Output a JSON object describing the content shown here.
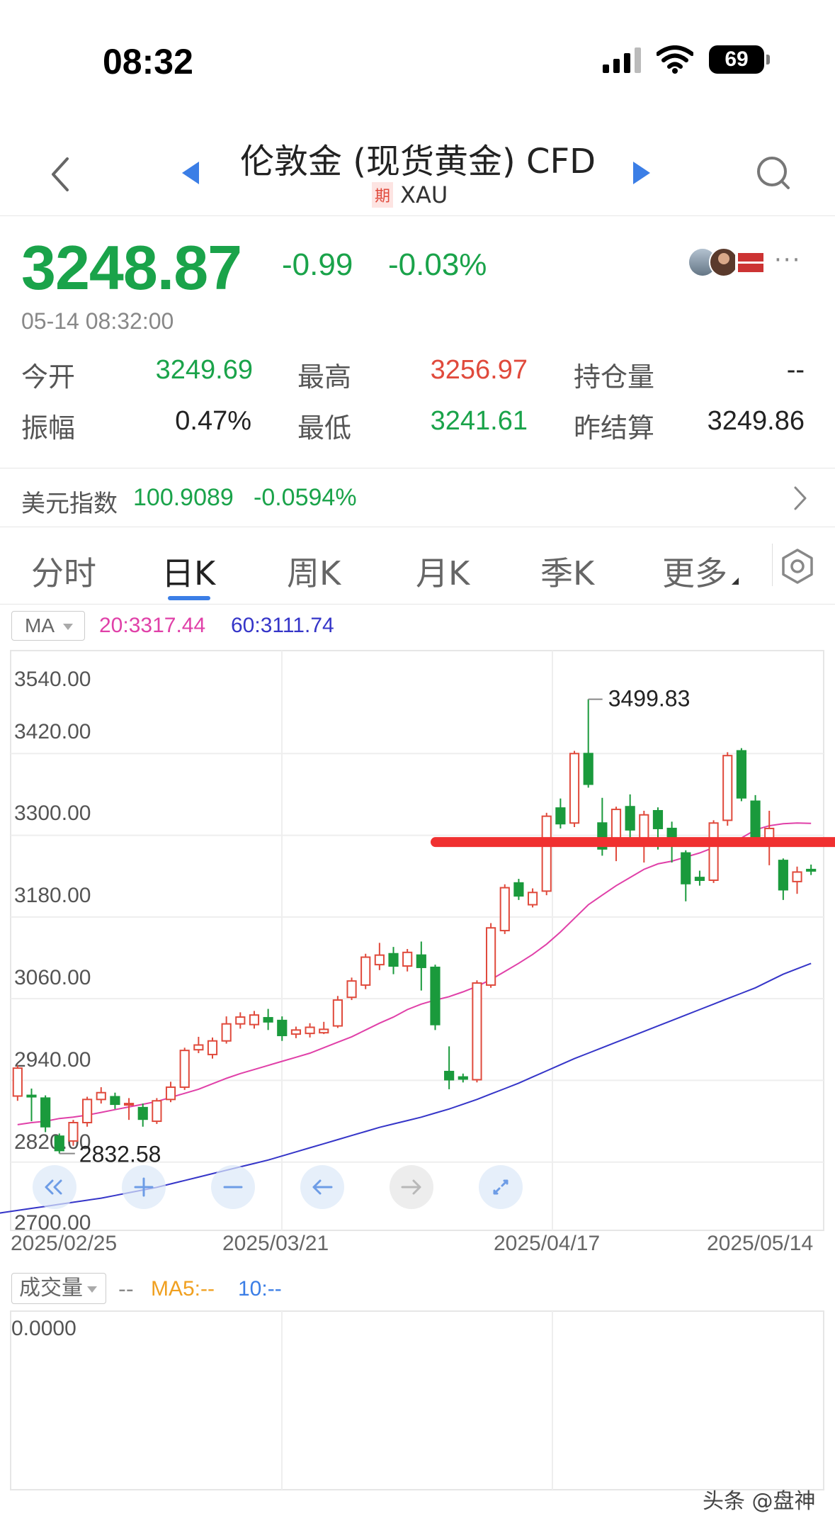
{
  "status": {
    "time": "08:32",
    "battery": "69"
  },
  "nav": {
    "title": "伦敦金 (现货黄金) CFD",
    "badge": "期",
    "code": "XAU"
  },
  "quote": {
    "price": "3248.87",
    "change": "-0.99",
    "change_pct": "-0.03%",
    "timestamp": "05-14 08:32:00",
    "stats": {
      "open_label": "今开",
      "open": "3249.69",
      "high_label": "最高",
      "high": "3256.97",
      "oi_label": "持仓量",
      "oi": "--",
      "amp_label": "振幅",
      "amp": "0.47%",
      "low_label": "最低",
      "low": "3241.61",
      "settle_label": "昨结算",
      "settle": "3249.86"
    }
  },
  "dxy": {
    "label": "美元指数",
    "value": "100.9089",
    "change": "-0.0594%"
  },
  "tabs": [
    "分时",
    "日K",
    "周K",
    "月K",
    "季K",
    "更多"
  ],
  "active_tab": "日K",
  "ma": {
    "select": "MA",
    "ma20": "20:3317.44",
    "ma60": "60:3111.74"
  },
  "volume": {
    "select": "成交量",
    "dash": "--",
    "ma5": "MA5:--",
    "ma10": "10:--",
    "zero": "0.0000"
  },
  "watermark": "头条 @盘神",
  "colors": {
    "up": "#e04a3c",
    "down": "#1a9a3c",
    "ma20": "#e040a8",
    "ma60": "#3535c8",
    "accent": "#3b7ee6",
    "marker": "#f03030"
  },
  "chart_data": {
    "type": "candlestick",
    "y_ticks": [
      "3540.00",
      "3420.00",
      "3300.00",
      "3180.00",
      "3060.00",
      "2940.00",
      "2820.00",
      "2700.00"
    ],
    "ylim": [
      2700,
      3540
    ],
    "x_labels": [
      "2025/02/25",
      "2025/03/21",
      "2025/04/17",
      "2025/05/14"
    ],
    "max_label": "3499.83",
    "min_label": "2832.58",
    "reference_level": 3290,
    "candles": [
      {
        "o": 2917,
        "c": 2958,
        "h": 2962,
        "l": 2910
      },
      {
        "o": 2918,
        "c": 2916,
        "h": 2928,
        "l": 2880
      },
      {
        "o": 2914,
        "c": 2872,
        "h": 2918,
        "l": 2864
      },
      {
        "o": 2858,
        "c": 2837,
        "h": 2862,
        "l": 2832.58
      },
      {
        "o": 2851,
        "c": 2878,
        "h": 2882,
        "l": 2844
      },
      {
        "o": 2878,
        "c": 2912,
        "h": 2916,
        "l": 2872
      },
      {
        "o": 2912,
        "c": 2922,
        "h": 2930,
        "l": 2906
      },
      {
        "o": 2916,
        "c": 2905,
        "h": 2922,
        "l": 2898
      },
      {
        "o": 2904,
        "c": 2906,
        "h": 2914,
        "l": 2882
      },
      {
        "o": 2900,
        "c": 2883,
        "h": 2906,
        "l": 2872
      },
      {
        "o": 2880,
        "c": 2910,
        "h": 2914,
        "l": 2876
      },
      {
        "o": 2912,
        "c": 2930,
        "h": 2938,
        "l": 2908
      },
      {
        "o": 2930,
        "c": 2984,
        "h": 2988,
        "l": 2926
      },
      {
        "o": 2985,
        "c": 2992,
        "h": 3004,
        "l": 2980
      },
      {
        "o": 2978,
        "c": 2998,
        "h": 3003,
        "l": 2972
      },
      {
        "o": 2998,
        "c": 3023,
        "h": 3034,
        "l": 2994
      },
      {
        "o": 3023,
        "c": 3033,
        "h": 3040,
        "l": 3016
      },
      {
        "o": 3022,
        "c": 3036,
        "h": 3042,
        "l": 3016
      },
      {
        "o": 3032,
        "c": 3026,
        "h": 3045,
        "l": 3014
      },
      {
        "o": 3028,
        "c": 3006,
        "h": 3034,
        "l": 2998
      },
      {
        "o": 3008,
        "c": 3014,
        "h": 3019,
        "l": 3002
      },
      {
        "o": 3009,
        "c": 3018,
        "h": 3024,
        "l": 3003
      },
      {
        "o": 3010,
        "c": 3015,
        "h": 3026,
        "l": 3008
      },
      {
        "o": 3020,
        "c": 3058,
        "h": 3064,
        "l": 3017
      },
      {
        "o": 3062,
        "c": 3086,
        "h": 3091,
        "l": 3058
      },
      {
        "o": 3080,
        "c": 3121,
        "h": 3126,
        "l": 3074
      },
      {
        "o": 3110,
        "c": 3124,
        "h": 3142,
        "l": 3102
      },
      {
        "o": 3126,
        "c": 3108,
        "h": 3136,
        "l": 3096
      },
      {
        "o": 3108,
        "c": 3128,
        "h": 3133,
        "l": 3100
      },
      {
        "o": 3124,
        "c": 3106,
        "h": 3144,
        "l": 3072
      },
      {
        "o": 3106,
        "c": 3022,
        "h": 3110,
        "l": 3014
      },
      {
        "o": 2953,
        "c": 2941,
        "h": 2990,
        "l": 2927
      },
      {
        "o": 2945,
        "c": 2942,
        "h": 2950,
        "l": 2937
      },
      {
        "o": 2941,
        "c": 3083,
        "h": 3087,
        "l": 2937
      },
      {
        "o": 3080,
        "c": 3164,
        "h": 3171,
        "l": 3076
      },
      {
        "o": 3160,
        "c": 3223,
        "h": 3228,
        "l": 3155
      },
      {
        "o": 3230,
        "c": 3211,
        "h": 3236,
        "l": 3205
      },
      {
        "o": 3198,
        "c": 3216,
        "h": 3222,
        "l": 3194
      },
      {
        "o": 3218,
        "c": 3328,
        "h": 3333,
        "l": 3212
      },
      {
        "o": 3340,
        "c": 3317,
        "h": 3354,
        "l": 3310
      },
      {
        "o": 3318,
        "c": 3420,
        "h": 3424,
        "l": 3312
      },
      {
        "o": 3420,
        "c": 3375,
        "h": 3499.83,
        "l": 3370
      },
      {
        "o": 3318,
        "c": 3280,
        "h": 3355,
        "l": 3270
      },
      {
        "o": 3288,
        "c": 3338,
        "h": 3342,
        "l": 3262
      },
      {
        "o": 3342,
        "c": 3308,
        "h": 3360,
        "l": 3283
      },
      {
        "o": 3286,
        "c": 3330,
        "h": 3336,
        "l": 3260
      },
      {
        "o": 3336,
        "c": 3310,
        "h": 3341,
        "l": 3279
      },
      {
        "o": 3310,
        "c": 3285,
        "h": 3320,
        "l": 3260
      },
      {
        "o": 3274,
        "c": 3229,
        "h": 3278,
        "l": 3203
      },
      {
        "o": 3238,
        "c": 3234,
        "h": 3248,
        "l": 3226
      },
      {
        "o": 3234,
        "c": 3318,
        "h": 3322,
        "l": 3230
      },
      {
        "o": 3322,
        "c": 3417,
        "h": 3422,
        "l": 3314
      },
      {
        "o": 3424,
        "c": 3355,
        "h": 3428,
        "l": 3350
      },
      {
        "o": 3350,
        "c": 3294,
        "h": 3359,
        "l": 3284
      },
      {
        "o": 3292,
        "c": 3310,
        "h": 3336,
        "l": 3256
      },
      {
        "o": 3263,
        "c": 3220,
        "h": 3266,
        "l": 3205
      },
      {
        "o": 3232,
        "c": 3246,
        "h": 3254,
        "l": 3214
      },
      {
        "o": 3249.69,
        "c": 3248.87,
        "h": 3256.97,
        "l": 3241.61
      }
    ],
    "ma20": [
      2875,
      2878,
      2880,
      2884,
      2886,
      2889,
      2893,
      2897,
      2901,
      2905,
      2909,
      2915,
      2921,
      2927,
      2935,
      2943,
      2950,
      2956,
      2962,
      2968,
      2974,
      2980,
      2988,
      2996,
      3004,
      3014,
      3024,
      3033,
      3044,
      3052,
      3058,
      3063,
      3070,
      3078,
      3088,
      3100,
      3112,
      3125,
      3140,
      3158,
      3178,
      3198,
      3212,
      3226,
      3238,
      3250,
      3258,
      3262,
      3268,
      3274,
      3282,
      3288,
      3296,
      3308,
      3314,
      3317,
      3318,
      3317.44
    ],
    "ma60": [
      2740,
      2743,
      2746,
      2749,
      2752,
      2755,
      2758,
      2761,
      2764,
      2767,
      2771,
      2775,
      2779,
      2783,
      2788,
      2793,
      2798,
      2803,
      2808,
      2813,
      2818,
      2823,
      2829,
      2835,
      2841,
      2847,
      2853,
      2859,
      2865,
      2871,
      2876,
      2881,
      2886,
      2892,
      2898,
      2905,
      2912,
      2920,
      2928,
      2936,
      2945,
      2954,
      2963,
      2972,
      2980,
      2988,
      2996,
      3004,
      3012,
      3020,
      3028,
      3036,
      3044,
      3052,
      3060,
      3068,
      3076,
      3086,
      3096,
      3104,
      3111.74
    ]
  }
}
